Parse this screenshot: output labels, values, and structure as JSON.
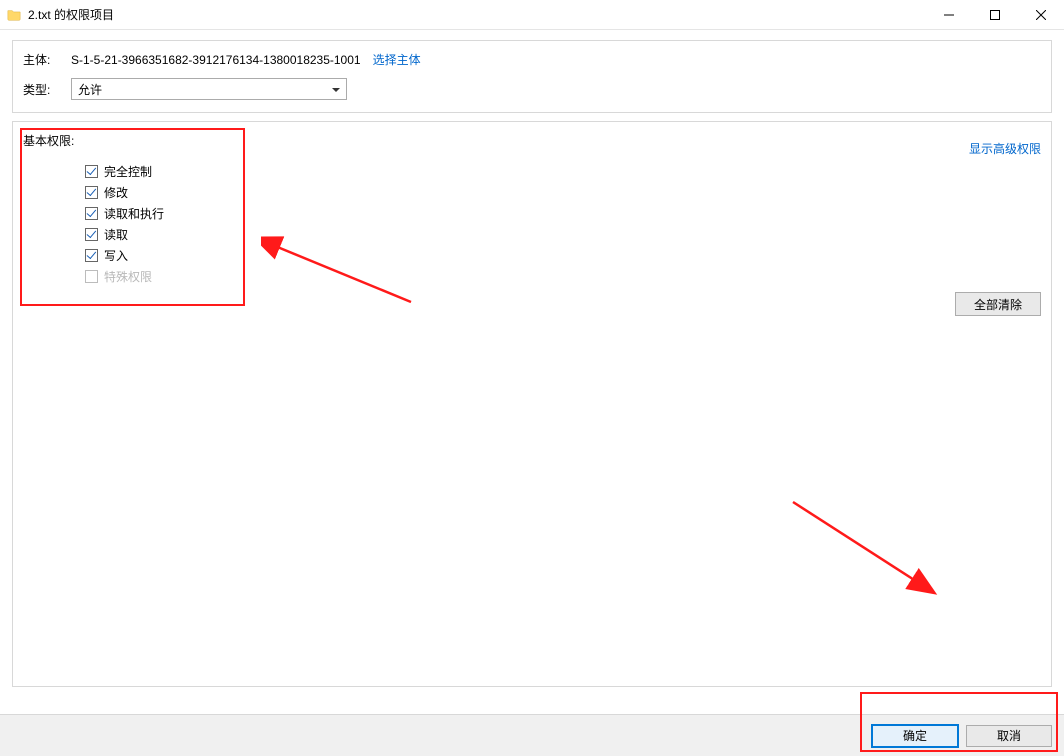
{
  "title": "2.txt 的权限项目",
  "header": {
    "principal_label": "主体:",
    "principal_value": "S-1-5-21-3966351682-3912176134-1380018235-1001",
    "select_principal_link": "选择主体",
    "type_label": "类型:",
    "type_value": "允许"
  },
  "permissions": {
    "title": "基本权限:",
    "show_advanced_link": "显示高级权限",
    "items": [
      {
        "label": "完全控制",
        "checked": true,
        "disabled": false
      },
      {
        "label": "修改",
        "checked": true,
        "disabled": false
      },
      {
        "label": "读取和执行",
        "checked": true,
        "disabled": false
      },
      {
        "label": "读取",
        "checked": true,
        "disabled": false
      },
      {
        "label": "写入",
        "checked": true,
        "disabled": false
      },
      {
        "label": "特殊权限",
        "checked": false,
        "disabled": true
      }
    ],
    "clear_all": "全部清除"
  },
  "footer": {
    "ok": "确定",
    "cancel": "取消"
  }
}
